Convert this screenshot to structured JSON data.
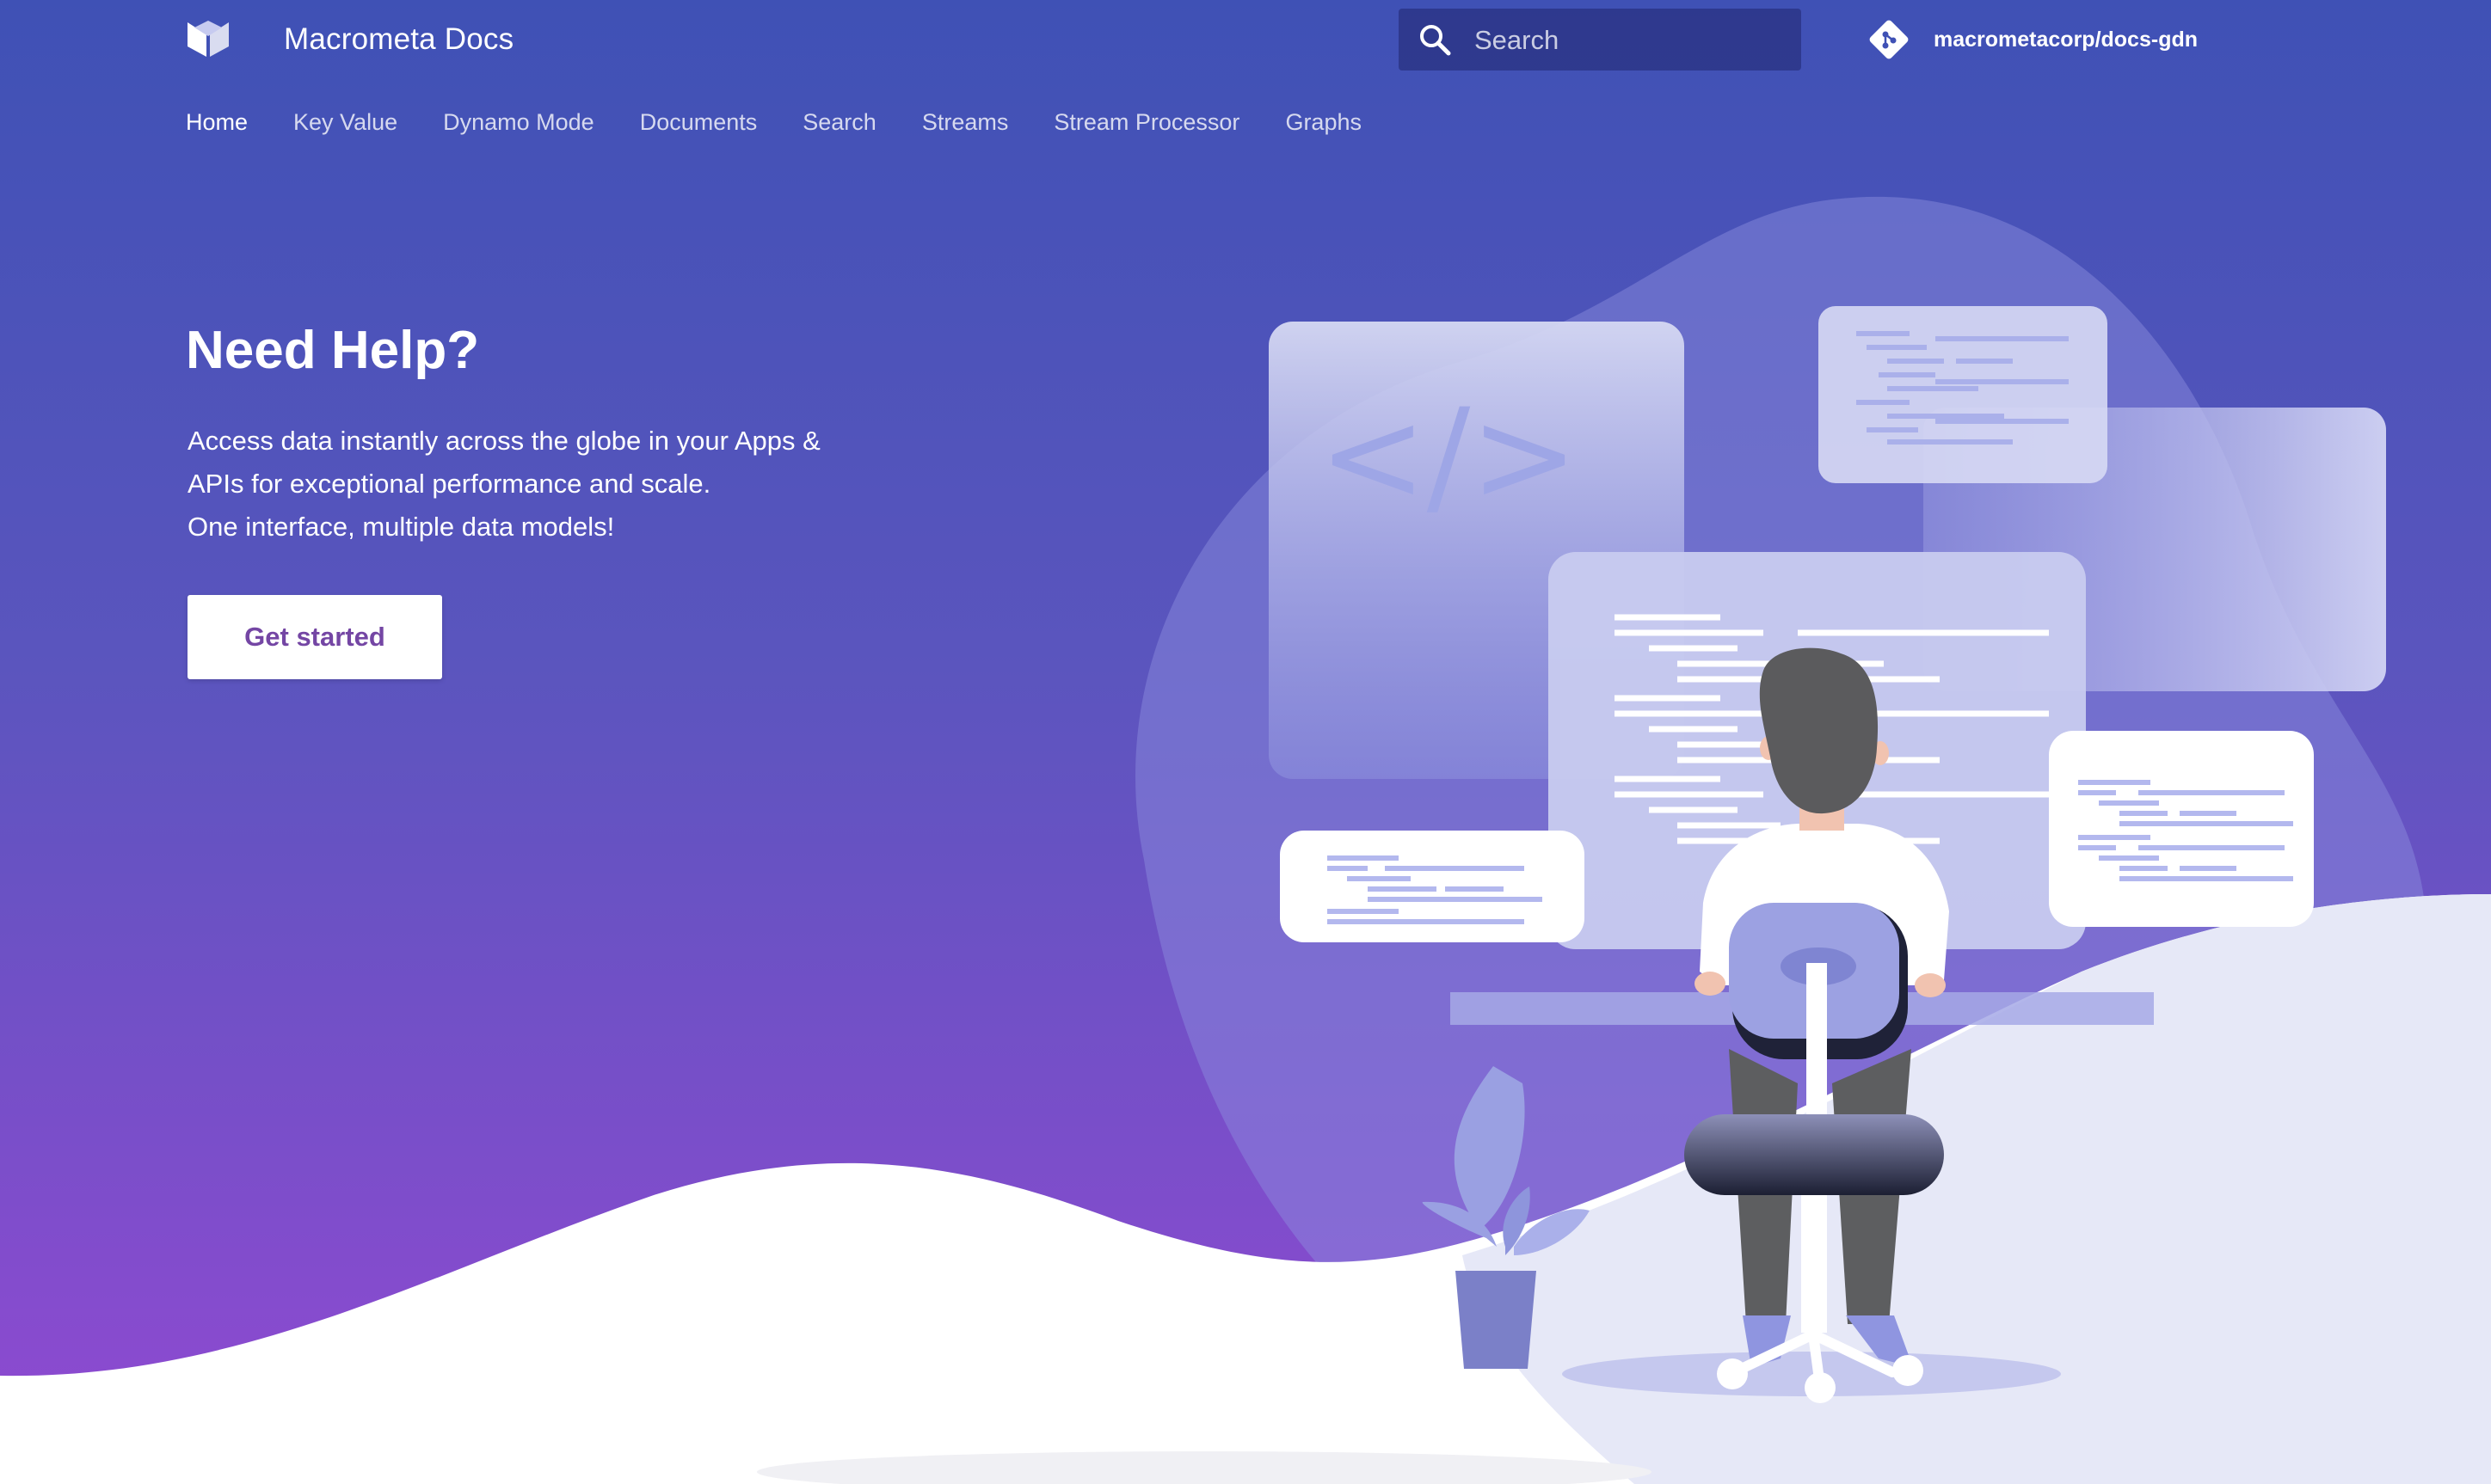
{
  "header": {
    "logo_icon": "macrometa-logo-icon",
    "title": "Macrometa Docs",
    "search": {
      "icon": "search-icon",
      "placeholder": "Search",
      "value": ""
    },
    "repo": {
      "icon": "git-icon",
      "name": "macrometacorp/docs-gdn"
    }
  },
  "nav": {
    "tabs": [
      {
        "label": "Home",
        "active": true
      },
      {
        "label": "Key Value",
        "active": false
      },
      {
        "label": "Dynamo Mode",
        "active": false
      },
      {
        "label": "Documents",
        "active": false
      },
      {
        "label": "Search",
        "active": false
      },
      {
        "label": "Streams",
        "active": false
      },
      {
        "label": "Stream Processor",
        "active": false
      },
      {
        "label": "Graphs",
        "active": false
      }
    ]
  },
  "hero": {
    "title": "Need Help?",
    "description_lines": [
      "Access data instantly across the globe in your Apps &",
      "APIs for exceptional performance and scale.",
      "One interface, multiple data models!"
    ],
    "cta_label": "Get started",
    "code_symbol": "</>",
    "illustration_icon": "developer-at-desk-illustration"
  },
  "colors": {
    "gradient_top": "#3f51b5",
    "gradient_bottom": "#8e4bd0",
    "cta_text": "#7446a4",
    "accent_light": "#e6e8f7"
  }
}
